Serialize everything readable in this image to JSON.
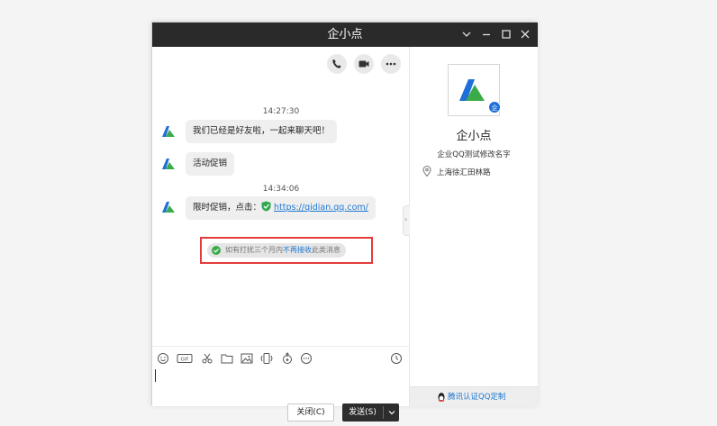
{
  "window": {
    "title": "企小点"
  },
  "messages": [
    {
      "time": "14:27:30",
      "text": "我们已经是好友啦，一起来聊天吧！"
    },
    {
      "text": "活动促销"
    },
    {
      "time": "14:34:06",
      "text": "限时促销，点击：",
      "link": "https://qidian.qq.com/"
    }
  ],
  "notice": {
    "before": "如有打扰三个月内",
    "highlight": "不再接收",
    "after": "此类消息"
  },
  "toolbar": {
    "icons": [
      "smiley-icon",
      "gif-icon",
      "scissors-icon",
      "folder-icon",
      "image-icon",
      "shake-icon",
      "red-packet-icon",
      "more-icon"
    ],
    "history_icon": "clock-icon"
  },
  "buttons": {
    "close": "关闭(C)",
    "send": "发送(S)"
  },
  "profile": {
    "name": "企小点",
    "badge": "企",
    "subtitle": "企业QQ测试修改名字",
    "address": "上海徐汇田林路",
    "footer_link": "腾讯认证QQ定制"
  },
  "colors": {
    "titlebar": "#2a2a2a",
    "link": "#1e78d2",
    "highlight_border": "#e33b3b",
    "logo_blue": "#1e6fd9",
    "logo_green": "#3bab49"
  }
}
